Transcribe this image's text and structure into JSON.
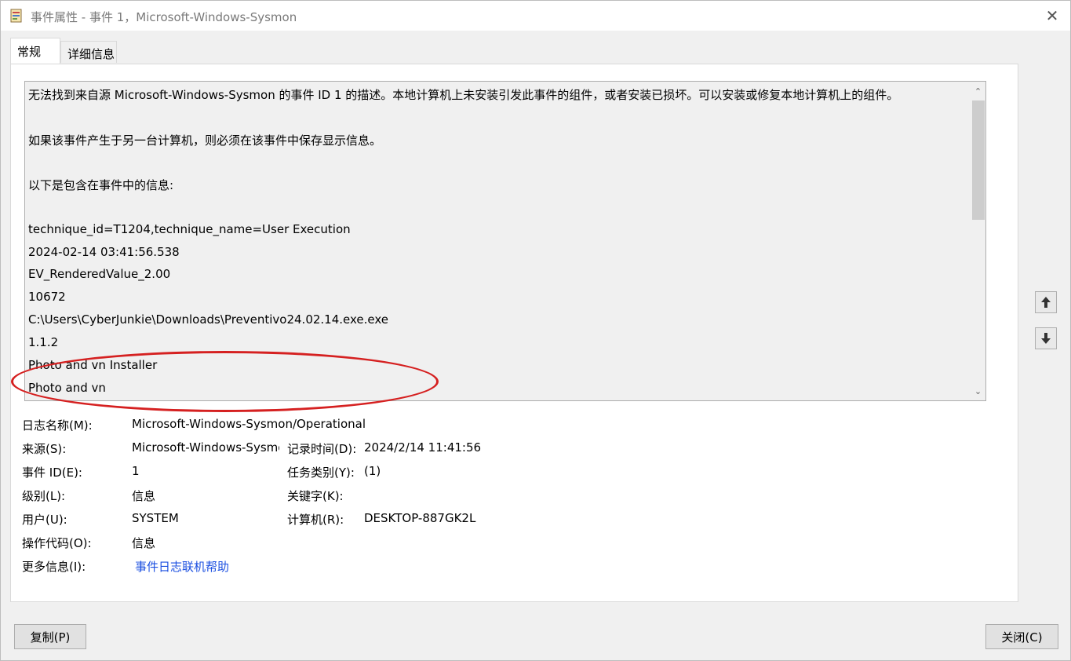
{
  "window": {
    "title": "事件属性 - 事件 1，Microsoft-Windows-Sysmon",
    "close_glyph": "✕"
  },
  "tabs": [
    {
      "label": "常规"
    },
    {
      "label": "详细信息"
    }
  ],
  "description": {
    "lines": [
      "无法找到来自源 Microsoft-Windows-Sysmon 的事件 ID 1 的描述。本地计算机上未安装引发此事件的组件，或者安装已损坏。可以安装或修复本地计算机上的组件。",
      "如果该事件产生于另一台计算机，则必须在该事件中保存显示信息。",
      "以下是包含在事件中的信息:",
      "technique_id=T1204,technique_name=User Execution",
      "2024-02-14 03:41:56.538",
      "EV_RenderedValue_2.00",
      "10672",
      "C:\\Users\\CyberJunkie\\Downloads\\Preventivo24.02.14.exe.exe",
      "1.1.2",
      "Photo and vn Installer",
      "Photo and vn"
    ],
    "highlight_color": "#d52020"
  },
  "fields": {
    "log_name_label": "日志名称(M):",
    "log_name_value": "Microsoft-Windows-Sysmon/Operational",
    "source_label": "来源(S):",
    "source_value": "Microsoft-Windows-Sysmon",
    "logged_label": "记录时间(D):",
    "logged_value": "2024/2/14 11:41:56",
    "event_id_label": "事件 ID(E):",
    "event_id_value": "1",
    "task_category_label": "任务类别(Y):",
    "task_category_value": "(1)",
    "level_label": "级别(L):",
    "level_value": "信息",
    "keywords_label": "关键字(K):",
    "keywords_value": "",
    "user_label": "用户(U):",
    "user_value": "SYSTEM",
    "computer_label": "计算机(R):",
    "computer_value": "DESKTOP-887GK2L",
    "opcode_label": "操作代码(O):",
    "opcode_value": "信息",
    "more_info_label": "更多信息(I):",
    "more_info_link": "事件日志联机帮助",
    "link_color": "#1b4fe0"
  },
  "buttons": {
    "copy": "复制(P)",
    "close": "关闭(C)",
    "prev_icon": "arrow-up-icon",
    "next_icon": "arrow-down-icon"
  }
}
